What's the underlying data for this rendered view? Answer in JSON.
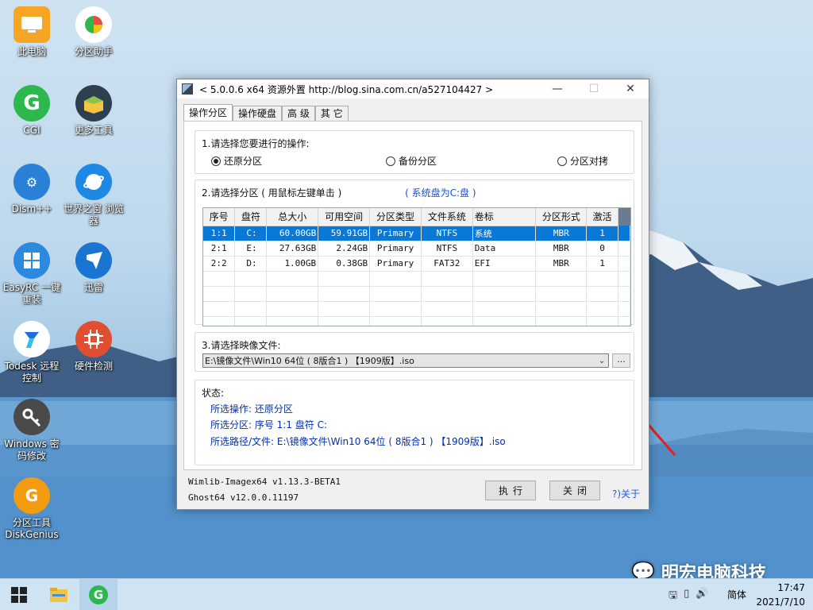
{
  "desktop": {
    "icons": [
      {
        "label": "此电脑",
        "icon": "computer-icon",
        "color": "#f0a030"
      },
      {
        "label": "分区助手",
        "icon": "partition-assistant-icon",
        "color": "#ffffff"
      },
      {
        "label": "CGI",
        "icon": "cgi-icon",
        "color": "#2db84d"
      },
      {
        "label": "更多工具",
        "icon": "toolbox-icon",
        "color": "#2e3f4f"
      },
      {
        "label": "Dism++",
        "icon": "dism-icon",
        "color": "#2a7fd6"
      },
      {
        "label": "世界之窗 浏览器",
        "icon": "browser-icon",
        "color": "#1e88e5"
      },
      {
        "label": "EasyRC 一键重装",
        "icon": "windows-icon",
        "color": "#2b8ae0"
      },
      {
        "label": "迅雷",
        "icon": "thunder-icon",
        "color": "#1a75d2"
      },
      {
        "label": "Todesk 远程控制",
        "icon": "todesk-icon",
        "color": "#ffffff"
      },
      {
        "label": "硬件检测",
        "icon": "chip-icon",
        "color": "#e05030"
      },
      {
        "label": "Windows 密码修改",
        "icon": "key-icon",
        "color": "#4a4a4a"
      },
      {
        "label": "分区工具DiskGenius",
        "icon": "diskgenius-icon",
        "color": "#f39c12"
      }
    ]
  },
  "window": {
    "title": "< 5.0.0.6 x64 资源外置 http://blog.sina.com.cn/a527104427 >",
    "tabs": [
      "操作分区",
      "操作硬盘",
      "高 级",
      "其 它"
    ],
    "step1": {
      "title": "1.请选择您要进行的操作:",
      "options": [
        {
          "label": "还原分区",
          "checked": true
        },
        {
          "label": "备份分区",
          "checked": false
        },
        {
          "label": "分区对拷",
          "checked": false
        }
      ]
    },
    "step2": {
      "title": "2.请选择分区 ( 用鼠标左键单击 )",
      "hint": "( 系统盘为C:盘 )",
      "columns": [
        "序号",
        "盘符",
        "总大小",
        "可用空间",
        "分区类型",
        "文件系统",
        "卷标",
        "分区形式",
        "激活"
      ],
      "rows": [
        [
          "1:1",
          "C:",
          "60.00GB",
          "59.91GB",
          "Primary",
          "NTFS",
          "系统",
          "MBR",
          "1"
        ],
        [
          "2:1",
          "E:",
          "27.63GB",
          "2.24GB",
          "Primary",
          "NTFS",
          "Data",
          "MBR",
          "0"
        ],
        [
          "2:2",
          "D:",
          "1.00GB",
          "0.38GB",
          "Primary",
          "FAT32",
          "EFI",
          "MBR",
          "1"
        ]
      ],
      "selected_row": 0
    },
    "step3": {
      "title": "3.请选择映像文件:",
      "value": "E:\\镜像文件\\Win10 64位 ( 8版合1 ) 【1909版】.iso",
      "browse_label": "..."
    },
    "status": {
      "title": "状态:",
      "lines": [
        "所选操作: 还原分区",
        "所选分区:    序号 1:1         盘符 C:",
        "所选路径/文件: E:\\镜像文件\\Win10 64位 ( 8版合1 ) 【1909版】.iso"
      ]
    },
    "footer": {
      "wimlib": "Wimlib-Imagex64 v1.13.3-BETA1",
      "ghost": "Ghost64 v12.0.0.11197",
      "execute_label": "执行",
      "close_label": "关闭",
      "about_label": "?)关于"
    }
  },
  "taskbar": {
    "ime": "简体",
    "time": "17:47",
    "date": "2021/7/10"
  },
  "watermark": "明宏电脑科技"
}
